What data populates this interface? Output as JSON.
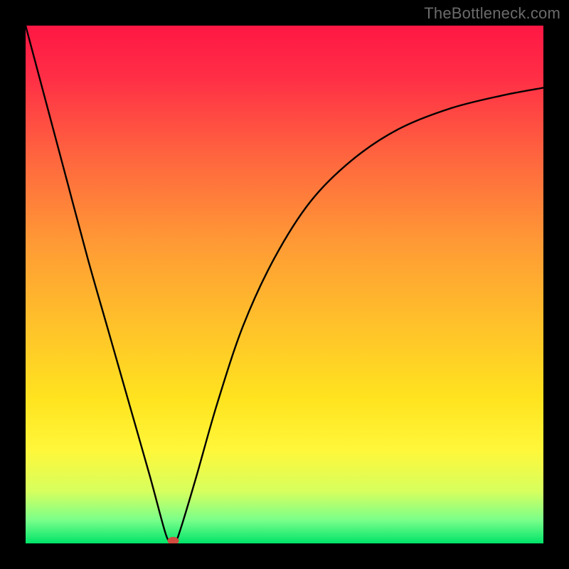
{
  "watermark": "TheBottleneck.com",
  "chart_data": {
    "type": "line",
    "title": "",
    "xlabel": "",
    "ylabel": "",
    "xlim": [
      0,
      100
    ],
    "ylim": [
      0,
      100
    ],
    "grid": false,
    "legend": false,
    "series": [
      {
        "name": "bottleneck-curve",
        "x": [
          0,
          4,
          8,
          12,
          16,
          20,
          24,
          27,
          28,
          29,
          30,
          33,
          37,
          42,
          48,
          55,
          63,
          72,
          82,
          92,
          100
        ],
        "y": [
          100,
          85,
          70,
          55,
          41,
          27,
          13,
          2,
          0.5,
          0.5,
          3,
          13,
          27,
          42,
          55,
          66,
          74,
          80,
          84,
          86.5,
          88
        ]
      }
    ],
    "marker": {
      "x": 28.5,
      "y": 0.5,
      "color": "#d14b3f"
    },
    "gradient_stops": [
      {
        "offset": 0.0,
        "color": "#ff1744"
      },
      {
        "offset": 0.1,
        "color": "#ff2e46"
      },
      {
        "offset": 0.25,
        "color": "#ff643f"
      },
      {
        "offset": 0.42,
        "color": "#ff9a35"
      },
      {
        "offset": 0.58,
        "color": "#ffc22a"
      },
      {
        "offset": 0.72,
        "color": "#ffe31f"
      },
      {
        "offset": 0.82,
        "color": "#fff73a"
      },
      {
        "offset": 0.9,
        "color": "#d6ff5e"
      },
      {
        "offset": 0.955,
        "color": "#7aff8a"
      },
      {
        "offset": 1.0,
        "color": "#00e46a"
      }
    ]
  }
}
